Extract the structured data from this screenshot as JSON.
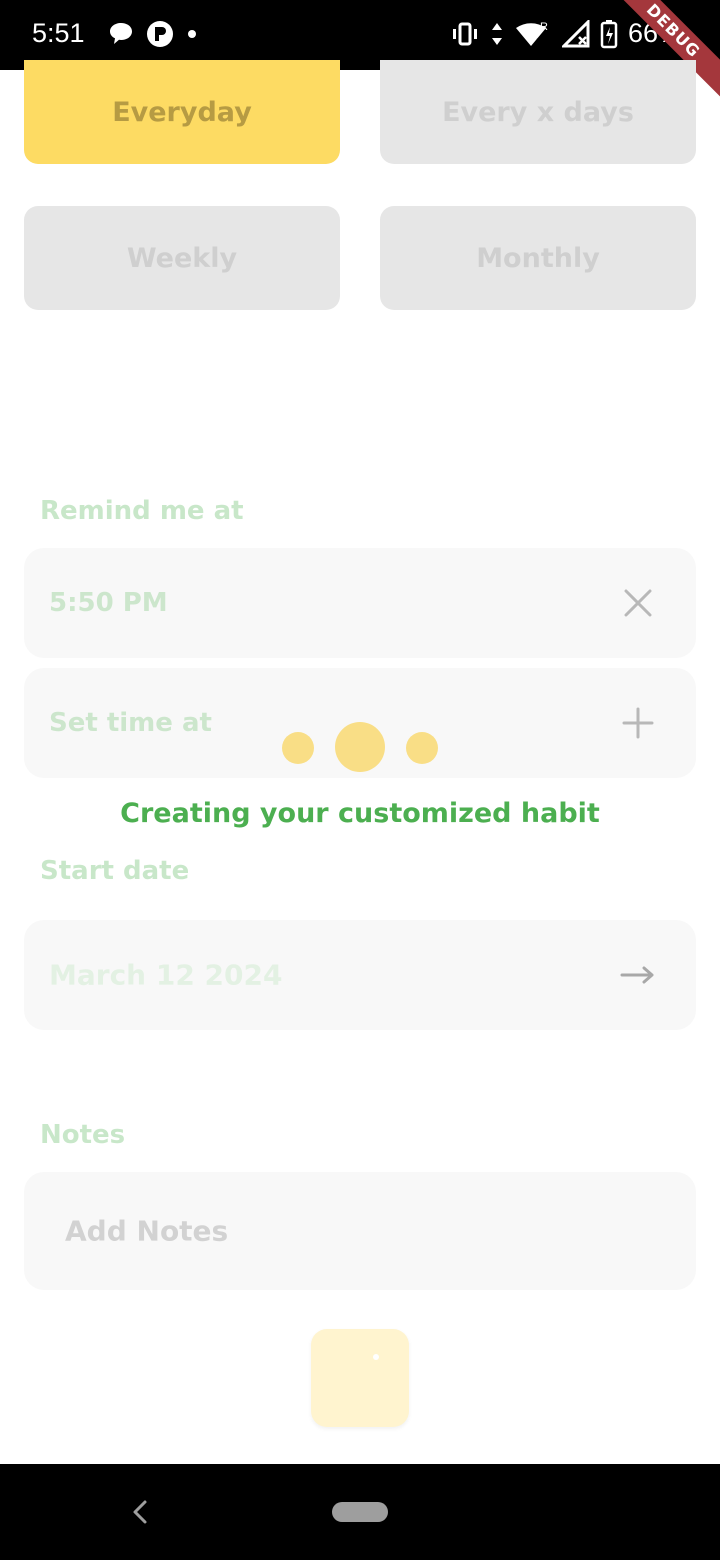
{
  "status_bar": {
    "time": "5:51",
    "battery_text": "66%",
    "debug_banner": "DEBUG",
    "icons_left": [
      "chat-bubble-icon",
      "p-app-icon",
      "dot-icon"
    ],
    "icons_right": [
      "vibrate-icon",
      "data-arrows-icon",
      "wifi-icon",
      "signal-icon",
      "battery-icon"
    ]
  },
  "frequency": {
    "options": [
      {
        "label": "Everyday",
        "selected": true
      },
      {
        "label": "Every x days",
        "selected": false
      },
      {
        "label": "Weekly",
        "selected": false
      },
      {
        "label": "Monthly",
        "selected": false
      }
    ]
  },
  "reminders": {
    "label": "Remind me at",
    "items": [
      {
        "text": "5:50 PM",
        "icon": "close-icon"
      },
      {
        "text": "Set time at",
        "icon": "plus-icon"
      }
    ]
  },
  "loading": {
    "text": "Creating your customized habit"
  },
  "start_date": {
    "label": "Start date",
    "value": "March 12 2024",
    "icon": "arrow-right-icon"
  },
  "notes": {
    "label": "Notes",
    "placeholder": "Add Notes"
  },
  "colors": {
    "accent_yellow": "#fddb63",
    "success_green": "#4caf50",
    "label_green_faded": "#c8e7c9"
  }
}
